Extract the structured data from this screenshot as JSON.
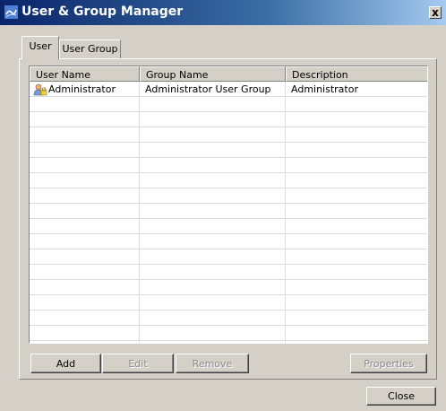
{
  "window": {
    "title": "User & Group Manager",
    "close_glyph": "x",
    "app_icon": "user-group-manager-app-icon"
  },
  "tabs": [
    {
      "label": "User",
      "selected": true
    },
    {
      "label": "User Group",
      "selected": false
    }
  ],
  "table": {
    "columns": [
      "User Name",
      "Group Name",
      "Description"
    ],
    "rows": [
      {
        "user_name": "Administrator",
        "group_name": "Administrator User Group",
        "description": "Administrator",
        "icon": "admin-user-icon"
      }
    ]
  },
  "buttons": {
    "add": {
      "label": "Add",
      "enabled": true
    },
    "edit": {
      "label": "Edit",
      "enabled": false
    },
    "remove": {
      "label": "Remove",
      "enabled": false
    },
    "properties": {
      "label": "Properties",
      "enabled": false
    },
    "close": {
      "label": "Close",
      "enabled": true
    }
  },
  "colors": {
    "dialog_face": "#d4d0c8",
    "titlebar_start": "#0a246a",
    "titlebar_end": "#a6caf0",
    "disabled_text": "#8a8a8a"
  }
}
